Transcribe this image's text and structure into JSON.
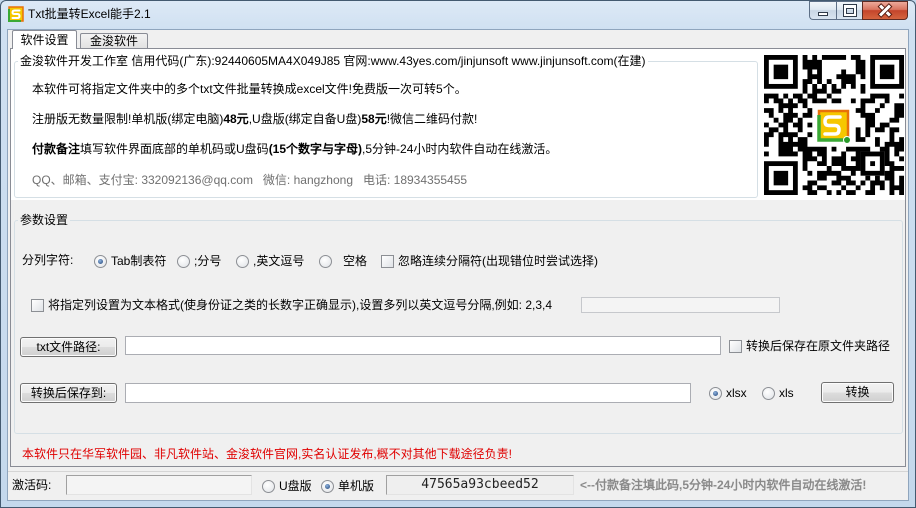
{
  "window": {
    "title": "Txt批量转Excel能手2.1"
  },
  "icons": {
    "app": "app-logo-icon",
    "minimize": "minimize-icon",
    "maximize": "maximize-icon",
    "close": "close-icon"
  },
  "colors": {
    "notice": "#e00000",
    "hint": "#8a8a8a",
    "contact": "#707070"
  },
  "tabs": [
    {
      "label": "软件设置",
      "active": true
    },
    {
      "label": "金浚软件",
      "active": false
    }
  ],
  "info": {
    "group_title": "金浚软件开发工作室 信用代码(广东):92440605MA4X049J85 官网:www.43yes.com/jinjunsoft  www.jinjunsoft.com(在建)",
    "line1": "本软件可将指定文件夹中的多个txt文件批量转换成excel文件!免费版一次可转5个。",
    "line2": {
      "a": "注册版无数量限制!单机版(绑定电脑)",
      "b": "48元",
      "c": ",U盘版(绑定自备U盘)",
      "d": "58元",
      "e": "!微信二维码付款!"
    },
    "line3": {
      "a": "付款备注",
      "b": "填写软件界面底部的单机码或U盘码",
      "c": "(15个数字与字母)",
      "d": ",5分钟-24小时内软件自动在线激活。"
    },
    "contact": "QQ、邮箱、支付宝: 332092136@qq.com   微信: hangzhong   电话: 18934355455"
  },
  "params": {
    "group_title": "参数设置",
    "delimiter_label": "分列字符:",
    "delimiters": [
      {
        "label": "Tab制表符",
        "selected": true
      },
      {
        "label": ";分号",
        "selected": false
      },
      {
        "label": ",英文逗号",
        "selected": false
      },
      {
        "label": "空格",
        "selected": false
      }
    ],
    "ignore_consecutive": {
      "label": "忽略连续分隔符(出现错位时尝试选择)",
      "checked": false
    },
    "text_columns": {
      "label": "将指定列设置为文本格式(使身份证之类的长数字正确显示),设置多列以英文逗号分隔,例如: 2,3,4",
      "checked": false,
      "value": ""
    },
    "source": {
      "button": "txt文件路径:",
      "value": "",
      "save_in_source": {
        "label": "转换后保存在原文件夹路径",
        "checked": false
      }
    },
    "target": {
      "button": "转换后保存到:",
      "value": ""
    },
    "formats": [
      {
        "label": "xlsx",
        "selected": true
      },
      {
        "label": "xls",
        "selected": false
      }
    ],
    "convert_button": "转换"
  },
  "notice": "本软件只在华军软件园、非凡软件站、金浚软件官网,实名认证发布,概不对其他下载途径负责!",
  "status": {
    "activation_label": "激活码:",
    "activation_value": "",
    "editions": [
      {
        "label": "U盘版",
        "selected": false
      },
      {
        "label": "单机版",
        "selected": true
      }
    ],
    "machine_code": "47565a93cbeed52",
    "hint": "<--付款备注填此码,5分钟-24小时内软件自动在线激活!"
  }
}
